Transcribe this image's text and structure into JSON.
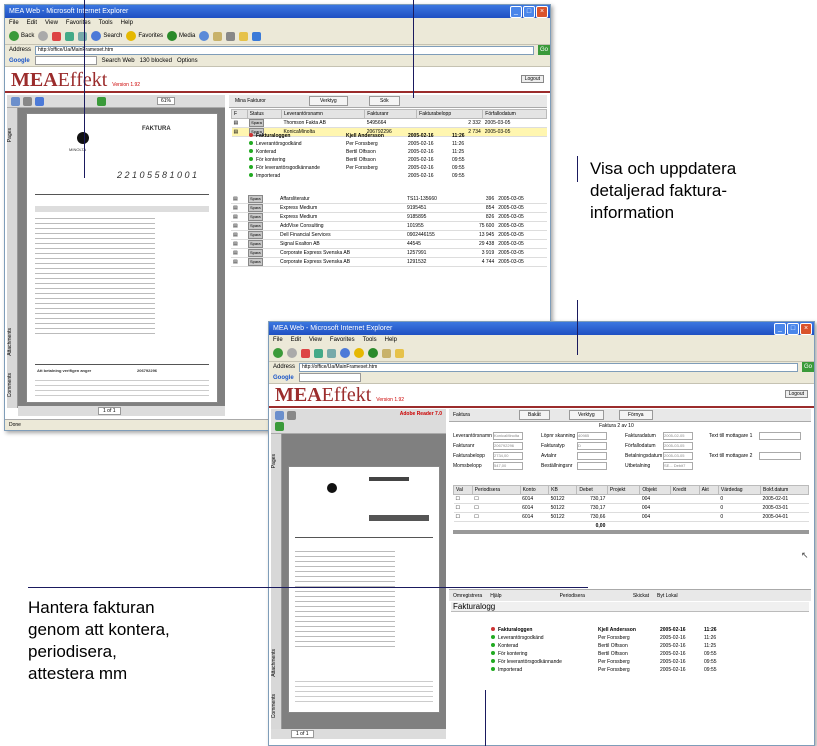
{
  "window1": {
    "title": "MEA Web - Microsoft Internet Explorer",
    "menu": [
      "File",
      "Edit",
      "View",
      "Favorites",
      "Tools",
      "Help"
    ],
    "toolbar": [
      "Back",
      "Search",
      "Favorites",
      "Media"
    ],
    "address_label": "Address",
    "address": "http://office/Ua/MainFrameset.htm",
    "go": "Go",
    "google_label": "Google",
    "google_items": [
      "Search Web",
      "130 blocked",
      "Options"
    ],
    "logo_prefix": "MEA",
    "logo_suffix": "Effekt",
    "version": "Version 1.92",
    "logout": "Logout",
    "tab_title": "Mina Fakturor",
    "tab_buttons": [
      "Verktyg",
      "Sök"
    ],
    "zoom": "61%",
    "columns": [
      "F",
      "Status",
      "Leverantörsnamn",
      "Fakturanr",
      "Fakturabelopp",
      "Förfallodatum"
    ],
    "rows": [
      {
        "status": "Spara",
        "name": "Thomson Fakta AB",
        "nr": "5495664",
        "amount": "2 332",
        "date": "2005-03-05"
      },
      {
        "status": "Spara",
        "name": "KonicaMinolta",
        "nr": "206792296",
        "amount": "2 734",
        "date": "2005-03-05"
      }
    ],
    "log_header": {
      "a": "Fakturaloggen",
      "b": "Kjell Andersson",
      "c": "2005-02-16",
      "d": "11:26"
    },
    "log": [
      {
        "a": "Leverantörsgodkänd",
        "b": "Per Forssberg",
        "c": "2005-02-16",
        "d": "11:26"
      },
      {
        "a": "Konterad",
        "b": "Bertil Olfsson",
        "c": "2005-02-16",
        "d": "11:25"
      },
      {
        "a": "För kontering",
        "b": "Bertil Olfsson",
        "c": "2005-02-16",
        "d": "09:55"
      },
      {
        "a": "För leverantörsgodkännande",
        "b": "Per Forssberg",
        "c": "2005-02-16",
        "d": "09:55"
      },
      {
        "a": "Importerad",
        "b": "",
        "c": "2005-02-16",
        "d": "09:55"
      }
    ],
    "rows2": [
      {
        "status": "Spara",
        "name": "Affarsliteratur",
        "nr": "TS11-135660",
        "amount": "396",
        "date": "2005-03-05"
      },
      {
        "status": "Spara",
        "name": "Express Medium",
        "nr": "9195451",
        "amount": "854",
        "date": "2005-03-05"
      },
      {
        "status": "Spara",
        "name": "Express Medium",
        "nr": "9185895",
        "amount": "826",
        "date": "2005-03-05"
      },
      {
        "status": "Spara",
        "name": "AddVise Consulting",
        "nr": "101955",
        "amount": "75 600",
        "date": "2005-03-05"
      },
      {
        "status": "Spara",
        "name": "Dell Financial Services",
        "nr": "0902446155",
        "amount": "13 945",
        "date": "2005-03-05"
      },
      {
        "status": "Spara",
        "name": "Signal Exalton AB",
        "nr": "44545",
        "amount": "29 438",
        "date": "2005-03-05"
      },
      {
        "status": "Spara",
        "name": "Corporate Express Svenska AB",
        "nr": "1257991",
        "amount": "3 919",
        "date": "2005-03-05"
      },
      {
        "status": "Spara",
        "name": "Corporate Express Svenska AB",
        "nr": "1291532",
        "amount": "4 744",
        "date": "2005-03-05"
      }
    ],
    "status": "Done",
    "page_nav": "1 of 1",
    "side_tabs": [
      "Pages",
      "Attachments",
      "Comments"
    ],
    "invoice": {
      "heading": "FAKTURA",
      "company": "MINOLTA",
      "ocr": "2 2 1 0 5 5 8 1 0 0 1",
      "total_label": "Att betalning verifigen anger",
      "total": "206792296"
    }
  },
  "window2": {
    "title": "MEA Web - Microsoft Internet Explorer",
    "menu": [
      "File",
      "Edit",
      "View",
      "Favorites",
      "Tools",
      "Help"
    ],
    "address_label": "Address",
    "address": "http://office/Ua/MainFrameset.htm",
    "go": "Go",
    "google_label": "Google",
    "logo_prefix": "MEA",
    "logo_suffix": "Effekt",
    "version": "Version 1.92",
    "logout": "Logout",
    "adobe": "Adobe Reader 7.0",
    "panel_title": "Faktura",
    "tabs": [
      "Bakåt",
      "Verktyg",
      "Förnya"
    ],
    "counter": "Faktura 2 av 10",
    "fields": [
      {
        "label": "Leverantörsnamn",
        "value": "KonicaMinolta"
      },
      {
        "label": "Fakturanr",
        "value": "206792296"
      },
      {
        "label": "Fakturabelopp",
        "value": "2734,00"
      },
      {
        "label": "Momsbelopp",
        "value": "547,00"
      }
    ],
    "fields2": [
      {
        "label": "Löpnr skanning",
        "value": "40985"
      },
      {
        "label": "Fakturatyp",
        "value": "D"
      },
      {
        "label": "Avtalnr",
        "value": ""
      },
      {
        "label": "Beställningsnr",
        "value": ""
      }
    ],
    "fields3": [
      {
        "label": "Fakturadatum",
        "value": "2005-02-05"
      },
      {
        "label": "Förfallodatum",
        "value": "2005-03-05"
      },
      {
        "label": "Betalningsdatum",
        "value": "2005-03-05"
      },
      {
        "label": "Utbetalning",
        "value": "SE... Debit7"
      }
    ],
    "fields4": [
      {
        "label": "Text till mottagare 1",
        "value": ""
      },
      {
        "label": "Text till mottagare 2",
        "value": ""
      }
    ],
    "grid_cols": [
      "Val",
      "Periodisera",
      "Konto",
      "KB",
      "Debet",
      "Projekt",
      "Objekt",
      "Kredit",
      "Akt",
      "Värdedag",
      "Bokf.datum"
    ],
    "grid_rows": [
      {
        "konto": "6014",
        "kb": "50122",
        "debet": "730,17",
        "obj": "004",
        "v": "0",
        "d": "2005-02-01"
      },
      {
        "konto": "6014",
        "kb": "50122",
        "debet": "730,17",
        "obj": "004",
        "v": "0",
        "d": "2005-03-01"
      },
      {
        "konto": "6014",
        "kb": "50122",
        "debet": "730,66",
        "obj": "004",
        "v": "0",
        "d": "2005-04-01"
      }
    ],
    "grid_total": "0,00",
    "action_bar": [
      "Omregistrera",
      "Hjälp",
      "Periodisera",
      "Skickat",
      "Byt Lokal"
    ],
    "log_title": "Fakturalogg",
    "log_header": {
      "a": "Fakturaloggen",
      "b": "Kjell Andersson",
      "c": "2005-02-16",
      "d": "11:26"
    },
    "log": [
      {
        "a": "Leverantörsgodkänd",
        "b": "Per Forssberg",
        "c": "2005-02-16",
        "d": "11:26"
      },
      {
        "a": "Konterad",
        "b": "Bertil Olfsson",
        "c": "2005-02-16",
        "d": "11:25"
      },
      {
        "a": "För kontering",
        "b": "Bertil Olfsson",
        "c": "2005-02-16",
        "d": "09:55"
      },
      {
        "a": "För leverantörsgodkännande",
        "b": "Per Forssberg",
        "c": "2005-02-16",
        "d": "09:55"
      },
      {
        "a": "Importerad",
        "b": "Per Forssberg",
        "c": "2005-02-16",
        "d": "09:55"
      }
    ],
    "page_nav": "1 of 1",
    "side_tabs": [
      "Pages",
      "Attachments",
      "Comments"
    ]
  },
  "captions": {
    "right": [
      "Visa och uppdatera",
      "detaljerad faktura-",
      "information"
    ],
    "left": [
      "Hantera fakturan",
      "genom att kontera,",
      "periodisera,",
      "attestera mm"
    ]
  },
  "colors": {
    "titlebar": "#2a5fd1",
    "accent": "#9b2c2c",
    "callout_line": "#1a1a5e"
  }
}
